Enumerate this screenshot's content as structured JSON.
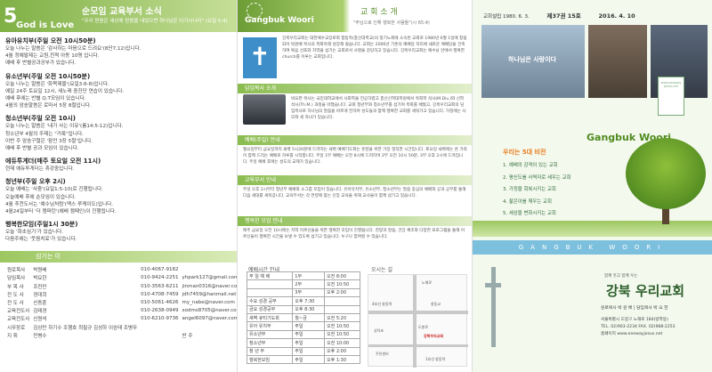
{
  "news": {
    "number": "5",
    "god_is_love": "God is Love",
    "title": "순모임 교육부서 소식",
    "verse": "\"우리 믿음은 세상에 믿음을 내었으면 하나님은 이기시니라\" (요일 5:4)",
    "sections": [
      {
        "heading": "유아유치부(주일 오전 10시50분)",
        "lines": [
          "오늘 나누는 말씀은 '감사하는 마음으로 드려요'(8단7,12)입니다.",
          "4월 정예발제는 교원,친척 아동 10명 입니다.",
          "예배 후 반별공과공부가 있습니다."
        ]
      },
      {
        "heading": "유소년부(주일 오전 10시50분)",
        "lines": [
          "오늘 나누는 말씀은 '화목제물'(요일3:6-8)입니다.",
          "예일 24주 토요일 12시, 새노래 중진단 연습이 있습니다.",
          "예배 후에는 반별 Q.T모임이 있습니다.",
          "4월의 암송말씀은 로마서 5장 8절입니다."
        ]
      },
      {
        "heading": "청소년부(주일 오전 10시)",
        "lines": [
          "오늘 나누는 말씀은 '내가 사는 이유'(롬14:5-12)입니다.",
          "청소년부 4월의 주제는 \"거룩\"입니다.",
          "이번 주 암송구절은 '잠언 3장 5절'입니다.",
          "예배 후 반별 공과 모임이 있습니다."
        ]
      },
      {
        "heading": "에듀투게더(매주 토요일 오전 11시)",
        "lines": [
          "현재 에듀투게더는 휴강중입니다."
        ]
      },
      {
        "heading": "청년부(주일 오후 2시)",
        "lines": [
          "오늘 예배는 '사줌'(요일1:5-10)로 진행됩니다.",
          "오늘예배 후에 순모임이 있습니다.",
          "4월 추천도서는 '예수님처럼'(맥스 루케이도)입니다.",
          "4월24일부터 '더 캠퍼턴'(예배 캠페인)이 진행됩니다."
        ]
      },
      {
        "heading": "행복한모임(주일1시 30분)",
        "lines": [
          "오늘 '화초심기'가 있습니다.",
          "다음주에는 '웃음치료'가 있습니다."
        ]
      }
    ],
    "contacts_title": "섬기는 이",
    "contacts": [
      [
        "원로목사",
        "박원배",
        "010-4067-9182",
        "",
        ""
      ],
      [
        "담임목사",
        "박요한",
        "010-9424-2251",
        "yhpark127@gmail.com",
        ""
      ],
      [
        "부 목 사",
        "조진만",
        "010-3563-6211",
        "jinman0316@naver.com",
        "청년부/장년/청소년부서"
      ],
      [
        "전 도 사",
        "정대희",
        "010-4708-7459",
        "jdh7459@hanmail.net",
        "청장년/유아부"
      ],
      [
        "전 도 사",
        "신동훈",
        "010-5061-4626",
        "my_nabe@naver.com",
        "유소년부"
      ],
      [
        "교육전도사",
        "김태경",
        "010-2638-0949",
        "xodms8705@naver.com",
        "청소년부"
      ],
      [
        "교육전도사",
        "신원석",
        "010-6210-9736",
        "angel6097@naver.com",
        "유아유치부"
      ],
      [
        "시무장로",
        "김상만  하기수  조행호  최필규  김성하  이승태  조병무",
        "",
        " ",
        ""
      ],
      [
        "지    휘",
        "민병수",
        "",
        "반    주",
        "김경희  오근례  이순희  이초희"
      ]
    ]
  },
  "intro": {
    "banner": "Gangbuk Woori",
    "title": "교 회 소 개",
    "verse": "\"주님으로 인해 행복한 사람들\"(시 65:4)",
    "text": "강북우리교회는 대한예수교장로회 합동측(총신대학교)의 정기노회에 소속된 교회로 1980년 6월 1일에 창립되어 박원배 목사의 목회아래 성장해 왔습니다. 교회는 2006년 기존의 예배당 자리에 새로운 예배당을 건축하여 복음 선포와 지역을 섬기는 교회로서 사명을 감당하고 있습니다. 강북우리교회는 예수님 안에서 행복한 church를 이루는 교회입니다.",
    "pastor_label": "담임목사 소개",
    "pastor_text": "박요한 목사는 국민대학교에서 사회학을 전공하였고 총신신학대학원에서 목회학 석사(M.Div.)와 신학 석사(Th.M.) 과정을 마쳤습니다. 교회 청년부와 청소년부를 섬기며 목회를 배웠고, 강북우리교회의 담임목사로 하나님의 말씀을 바르게 전하며 성도들과 함께 행복한 교회를 세워가고 있습니다. 가정에는 사모와 세 자녀가 있습니다.",
    "block_labels": [
      "예배(주일) 안내",
      "교육부서 안내",
      "행복한 모임 안내"
    ],
    "block_texts": [
      "월요일부터 금요일까지 새벽 5시20분에 드려지는 새벽 예배기도회는 훈련을 위한 가장 정직한 시간입니다. 토요일 새벽에는 온 가족이 함께 드리는 예배로 하루를 시작합니다. 주일 1부 예배는 오전 8시에 드려지며 2부 오전 10시 50분, 3부 오후 2시에 드려집니다. 주일 예배 후에는 성도의 교제가 있습니다.",
      "주일 오후 2시부터 청년부 예배와 소그룹 모임이 있습니다. 유아유치부, 유소년부, 청소년부는 말씀 중심의 예배와 공과 공부를 통해 다음 세대를 세워갑니다. 교육부서는 각 연령에 맞는 신앙 교육을 위해 교사들이 함께 섬기고 있습니다.",
      "매주 금요일 오전 10시에는 지역 어르신들을 위한 행복한 모임이 진행됩니다. 찬양과 말씀, 건강 체조와 다양한 프로그램을 통해 어르신들이 행복한 시간을 보낼 수 있도록 섬기고 있습니다. 누구나 참여할 수 있습니다."
    ],
    "worship_label": "예배시간 안내",
    "map_label": "오시는 길",
    "worship_rows": [
      [
        "주 일 예 배",
        "1부",
        "오전 8:00"
      ],
      [
        "",
        "2부",
        "오전 10:50"
      ],
      [
        "",
        "3부",
        "오후 2:00"
      ],
      [
        "수요 성경 공부",
        "오후 7:30",
        ""
      ],
      [
        "금요 성경공부",
        "오후 8:30",
        ""
      ],
      [
        "새벽 큐티기도회",
        "월~금",
        "오전 5:20"
      ],
      [
        "유아 유치부",
        "주일",
        "오전 10:50"
      ],
      [
        "유소년부",
        "주일",
        "오전 10:50"
      ],
      [
        "청소년부",
        "주일",
        "오전 10:00"
      ],
      [
        "청 년 부",
        "주일",
        "오후 2:00"
      ],
      [
        "행복한모임",
        "주일",
        "오후 1:30"
      ]
    ],
    "map_places": [
      "노해로",
      "4호선 창동역",
      "창동교",
      "도봉로",
      "성덕초",
      "강북우리교회",
      "주민센터",
      "1호선 창동역"
    ]
  },
  "cover": {
    "founded": "교회설립 1980. 6. 3.",
    "volume": "제37권 15호",
    "date": "2016. 4. 10",
    "sign_text": "하나님은 사랑이다",
    "qr_text": "www.oneway jesus.net",
    "logo": "Gangbuk Woori",
    "vision_title": "우리는 5대 비전",
    "visions": [
      "1. 예배의 감격이 있는 교회",
      "2. 평신도를 사역자로 세우는 교회",
      "3. 가정을 회복시키는 교회",
      "4. 젊은이를 깨우는 교회",
      "5. 세상을 변화시키는 교회"
    ],
    "banner": "GANGBUK WOORI",
    "slogan": "함께 웃고 함께 우는",
    "church_name": "강북 우리교회",
    "pastors": "원로목사 박 원 배 | 담임목사 박 요 한",
    "address": "서울특별시 도봉구 노해로 184(방학동)",
    "tel": "TEL. 02)903-2234  FAX. 02)988-2253",
    "url": "홈페이지 www.onewayjesus.net"
  }
}
